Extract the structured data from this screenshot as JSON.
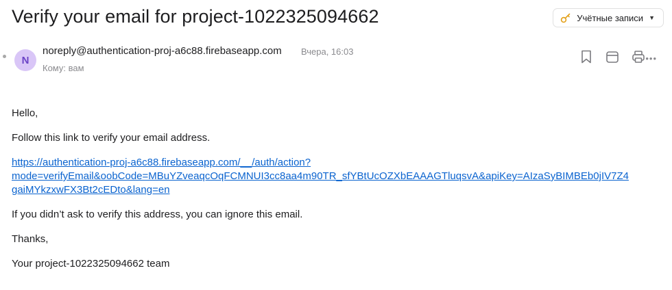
{
  "email": {
    "subject": "Verify your email for project-1022325094662",
    "accounts_button": {
      "label": "Учётные записи",
      "icon": "key-icon"
    },
    "sender": {
      "avatar_letter": "N",
      "address": "noreply@authentication-proj-a6c88.firebaseapp.com",
      "time": "Вчера, 16:03"
    },
    "recipient": "Кому: вам",
    "actions": {
      "bookmark": {
        "icon": "bookmark-icon"
      },
      "calendar": {
        "icon": "calendar-icon"
      },
      "print": {
        "icon": "printer-icon"
      },
      "more": {
        "label": "•••"
      }
    },
    "body": {
      "greeting": "Hello,",
      "instruction": "Follow this link to verify your email address.",
      "link_line1": "https://authentication-proj-a6c88.firebaseapp.com/__/auth/action?",
      "link_line2": "mode=verifyEmail&oobCode=MBuYZveaqcOqFCMNUI3cc8aa4m90TR_sfYBtUcOZXbEAAAGTluqsvA&apiKey=AIzaSyBIMBEb0jIV7Z4",
      "link_line3": "gaiMYkzxwFX3Bt2cEDto&lang=en",
      "ignore_note": "If you didn’t ask to verify this address, you can ignore this email.",
      "thanks": "Thanks,",
      "signature": "Your project-1022325094662 team"
    }
  },
  "colors": {
    "link": "#0a63cf",
    "avatar_bg": "#d9c6f7",
    "avatar_text": "#6b43c6",
    "key_icon": "#e3a018"
  }
}
